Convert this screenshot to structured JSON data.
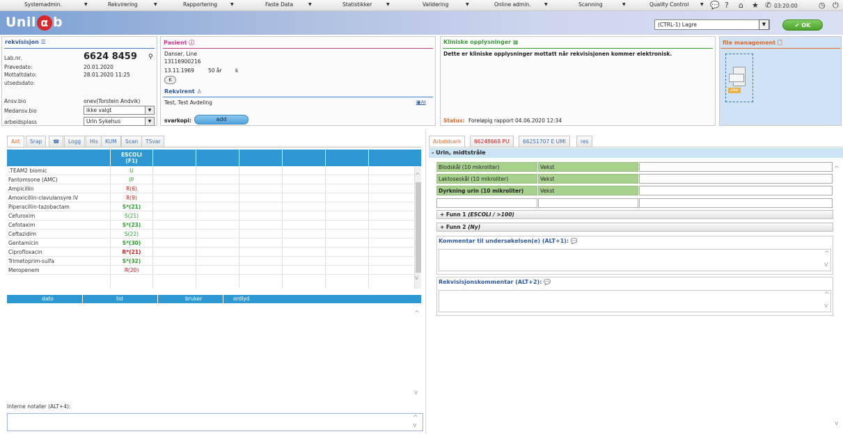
{
  "menu": {
    "items": [
      {
        "label": "Systemadmin."
      },
      {
        "label": "Rekvirering"
      },
      {
        "label": "Rapportering"
      },
      {
        "label": "Faste Data"
      },
      {
        "label": "Statistikker"
      },
      {
        "label": "Validering"
      },
      {
        "label": "Online admin."
      },
      {
        "label": "Scanning"
      },
      {
        "label": "Quality Control"
      }
    ],
    "clock": "03:20:00",
    "icons": [
      "chat-icon",
      "help-icon",
      "home-icon",
      "star-icon",
      "phone-icon",
      "clock-icon",
      "power-icon"
    ]
  },
  "header": {
    "logo_text_left": "Unil",
    "logo_alpha": "α",
    "logo_text_right": "b",
    "save_select": "(CTRL-1) Lagre",
    "ok_label": "✔ OK"
  },
  "rekvisisjon": {
    "title": "rekvisisjon",
    "labnr_label": "Lab.nr.",
    "labnr_value": "6624 8459",
    "provedato_label": "Prøvedato:",
    "provedato_value": "20.01.2020",
    "mottattdato_label": "Mottattdato:",
    "mottattdato_value": "28.01.2020 11:25",
    "utsedsdato_label": "utsedsdato:",
    "ansvbio_label": "Ansv.bio",
    "ansvbio_value": "onev(Torstein Andvik)",
    "medansvbio_label": "Medansv.bio",
    "medansvbio_value": "ikke valgt",
    "arbeidsplass_label": "arbeidsplass",
    "arbeidsplass_value": "Urin Sykehus"
  },
  "pasient": {
    "title": "Pasient",
    "name": "Danser, Line",
    "id": "13116900216",
    "dob": "13.11.1969",
    "age": "50 år",
    "sex": "k",
    "k_button": "K",
    "rekvirent_title": "Rekvirent",
    "rekvirent_value": "Test, Test Avdeling",
    "ai_link": "AI",
    "svarkopi_label": "svarkopi:",
    "add_button": "add"
  },
  "kliniske": {
    "title": "Kliniske opplysninger",
    "text": "Dette er kliniske opplysninger mottatt når rekvisisjonen kommer elektronisk.",
    "status_label": "Status:",
    "status_value": "Foreløpig rapport 04.06.2020 12:34"
  },
  "file_management": {
    "title": "file management",
    "file_label": "aftel"
  },
  "left_tabs": [
    "Ant",
    "Srap",
    "☎",
    "Logg",
    "His",
    "KUM",
    "Scan",
    "TSvar"
  ],
  "antibiogram": {
    "column_header": "ESCOLI",
    "column_sub": "(F1)",
    "rows": [
      {
        "name": ".TEAM2 biomic",
        "result": "U",
        "color": "#2e9a2e",
        "bold": false
      },
      {
        "name": "Fantomsone (AMC)",
        "result": "IP",
        "color": "#2e9a2e",
        "bold": false
      },
      {
        "name": "Ampicillin",
        "result": "R(6)",
        "color": "#d02020",
        "bold": false
      },
      {
        "name": "Amoxicillin-clavulansyre IV",
        "result": "R(9)",
        "color": "#d02020",
        "bold": false
      },
      {
        "name": "Piperacillin-tazobactam",
        "result": "S*(21)",
        "color": "#2e9a2e",
        "bold": true
      },
      {
        "name": "Cefuroxim",
        "result": "S(21)",
        "color": "#2e9a2e",
        "bold": false
      },
      {
        "name": "Cefotaxim",
        "result": "S*(23)",
        "color": "#2e9a2e",
        "bold": true
      },
      {
        "name": "Ceftazidim",
        "result": "S(22)",
        "color": "#2e9a2e",
        "bold": false
      },
      {
        "name": "Gentamicin",
        "result": "S*(30)",
        "color": "#2e9a2e",
        "bold": true
      },
      {
        "name": "Ciprofloxacin",
        "result": "R*(21)",
        "color": "#d02020",
        "bold": true
      },
      {
        "name": "Trimetoprim-sulfa",
        "result": "S*(32)",
        "color": "#2e9a2e",
        "bold": true
      },
      {
        "name": "Meropenem",
        "result": "R(20)",
        "color": "#d02020",
        "bold": false
      }
    ]
  },
  "log_table": {
    "headers": [
      "dato",
      "tid",
      "bruker",
      "ordlyd"
    ]
  },
  "internal_notes": {
    "label": "Interne notater (ALT+4):"
  },
  "right_tabs": [
    {
      "label": "Arbeidsark",
      "color": "#e06a2c"
    },
    {
      "label": "66248668 PU",
      "color": "#d02020"
    },
    {
      "label": "66251707 E UMI",
      "color": "#3b6fb0"
    },
    {
      "label": "res",
      "color": "#3b6fb0"
    }
  ],
  "worksheet": {
    "section_title": "- Urin, midtstråle",
    "rows": [
      {
        "name": "Blodskål (10 mikroliter)",
        "value": "Vekst",
        "bold": false
      },
      {
        "name": "Laktoseskål (10 mikroliter)",
        "value": "Vekst",
        "bold": false
      },
      {
        "name": "Dyrkning urin (10 mikroliter)",
        "value": "Vekst",
        "bold": true
      }
    ],
    "funn": [
      {
        "prefix": "+ Funn 1 ",
        "detail": "(ESCOLI / >100)"
      },
      {
        "prefix": "+ Funn 2 ",
        "detail": "(Ny)"
      }
    ],
    "kommentar_label": "Kommentar til undersøkelsen(e) (ALT+1):",
    "rekv_kommentar_label": "Rekvisisjonskommentar (ALT+2):"
  }
}
